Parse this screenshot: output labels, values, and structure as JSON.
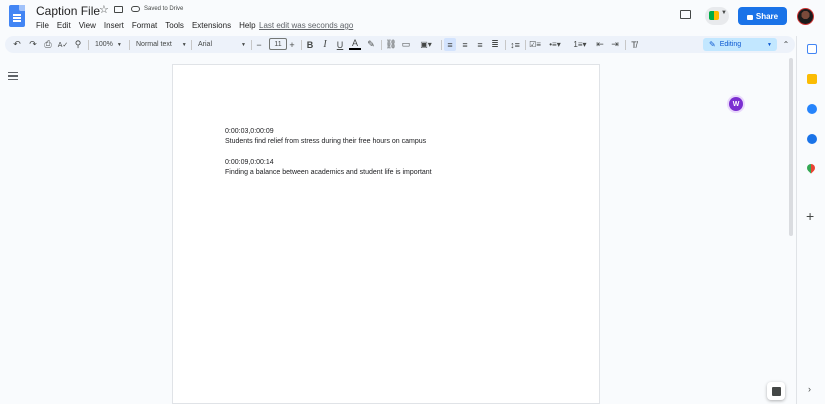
{
  "header": {
    "title": "Caption File",
    "save_status": "Saved to Drive",
    "last_edit": "Last edit was seconds ago",
    "share_label": "Share"
  },
  "menu": {
    "items": [
      "File",
      "Edit",
      "View",
      "Insert",
      "Format",
      "Tools",
      "Extensions",
      "Help"
    ]
  },
  "toolbar": {
    "zoom": "100%",
    "style": "Normal text",
    "font": "Arial",
    "font_size": "11",
    "mode": "Editing"
  },
  "document": {
    "lines": [
      "0:00:03,0:00:09",
      "Students find relief from stress during their free hours on campus",
      "0:00:09,0:00:14",
      "Finding a balance between academics and student life is important"
    ]
  },
  "colors": {
    "accent": "#1a73e8",
    "toolbar_bg": "#edf2fa",
    "editing_bg": "#c2e7ff"
  }
}
